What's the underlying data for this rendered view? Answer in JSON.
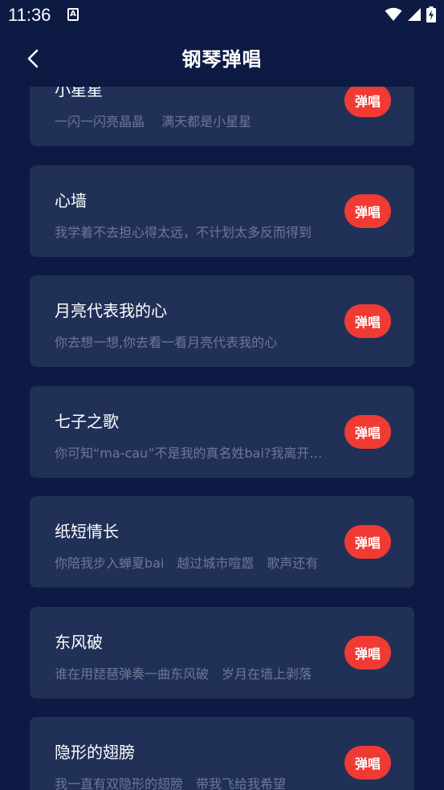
{
  "status_bar": {
    "time": "11:36",
    "notification_glyph": "A",
    "icons": [
      "wifi-icon",
      "signal-icon",
      "battery-charging-icon"
    ]
  },
  "header": {
    "title": "钢琴弹唱",
    "back_icon": "chevron-left-icon"
  },
  "colors": {
    "background": "#0d1a43",
    "card": "#213057",
    "accent": "#ef3b33",
    "lyric_text": "#6d7896"
  },
  "songs": [
    {
      "title": "小星星",
      "lyric": "一闪一闪亮晶晶　 满天都是小星星",
      "button_label": "弹唱"
    },
    {
      "title": "心墙",
      "lyric": "我学着不去担心得太远，不计划太多反而得到",
      "button_label": "弹唱"
    },
    {
      "title": "月亮代表我的心",
      "lyric": "你去想一想,你去看一看月亮代表我的心",
      "button_label": "弹唱"
    },
    {
      "title": "七子之歌",
      "lyric": "你可知“ma-cau”不是我的真名姓bai?我离开你太久了",
      "button_label": "弹唱"
    },
    {
      "title": "纸短情长",
      "lyric": "你陪我步入蝉夏bai　越过城市喧嚣　歌声还有",
      "button_label": "弹唱"
    },
    {
      "title": "东风破",
      "lyric": "谁在用琵琶弹奏一曲东风破　岁月在墙上剥落",
      "button_label": "弹唱"
    },
    {
      "title": "隐形的翅膀",
      "lyric": "我一直有双隐形的翅膀　带我飞给我希望",
      "button_label": "弹唱"
    }
  ]
}
